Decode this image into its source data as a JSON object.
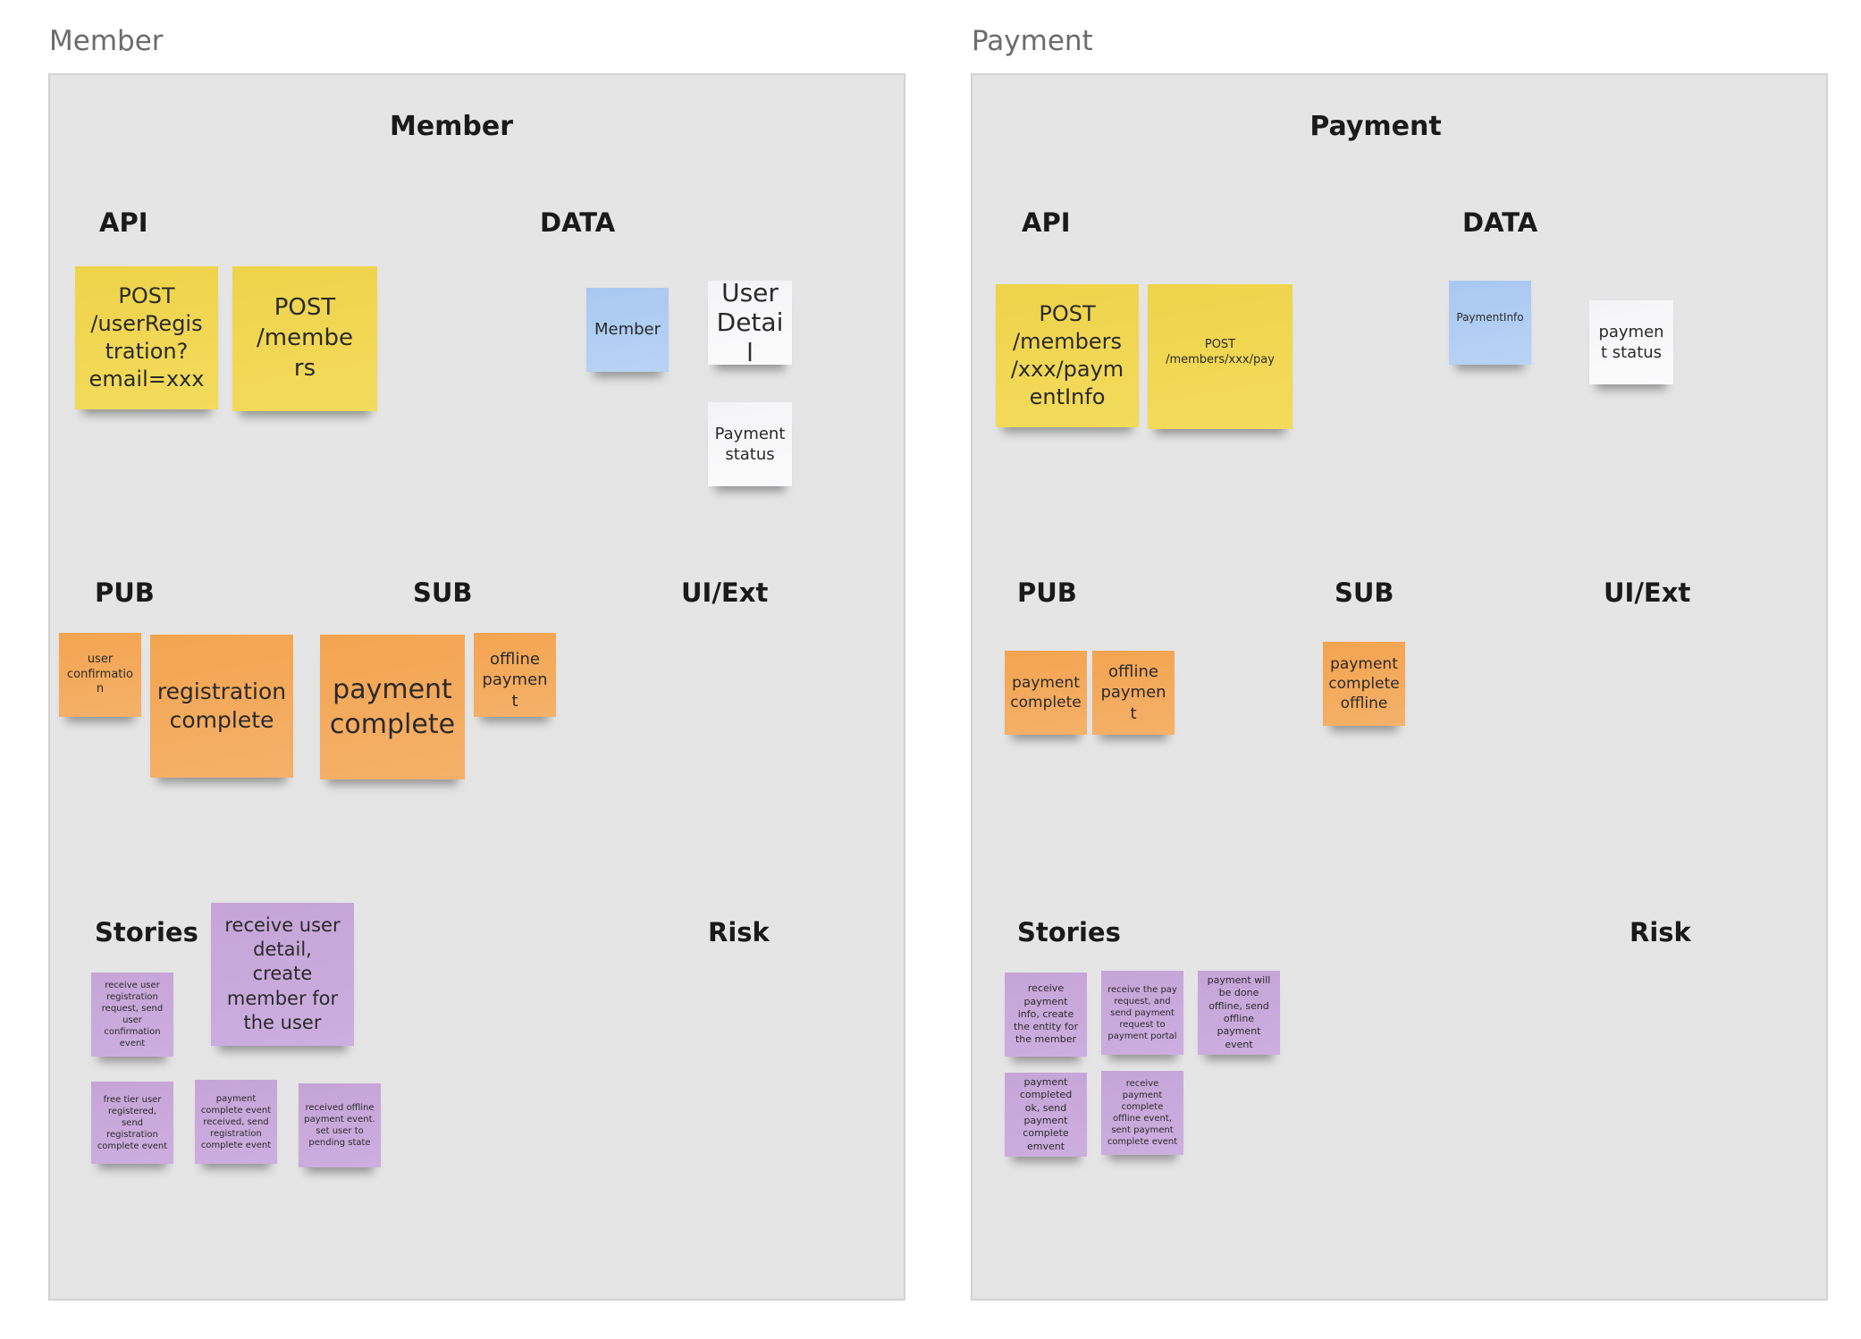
{
  "frames": {
    "member": {
      "label": "Member",
      "title": "Member",
      "headings": {
        "api": "API",
        "data": "DATA",
        "pub": "PUB",
        "sub": "SUB",
        "ui": "UI/Ext",
        "stories": "Stories",
        "risk": "Risk"
      },
      "api": [
        {
          "text": "POST /userRegistration?email=xxx",
          "color": "yellow"
        },
        {
          "text": "POST /members",
          "color": "yellow"
        }
      ],
      "data": [
        {
          "text": "Member",
          "color": "blue"
        },
        {
          "text": "User Detail",
          "color": "white"
        },
        {
          "text": "Payment status",
          "color": "white"
        }
      ],
      "pub": [
        {
          "text": "user confirmation",
          "color": "orange"
        },
        {
          "text": "registration complete",
          "color": "orange"
        }
      ],
      "sub": [
        {
          "text": "payment complete",
          "color": "orange"
        },
        {
          "text": "offline payment",
          "color": "orange"
        }
      ],
      "stories": [
        {
          "text": "receive user detail, create member for the user",
          "color": "purple"
        },
        {
          "text": "receive user registration request, send user confirmation event",
          "color": "purple"
        },
        {
          "text": "free tier user registered, send registration complete event",
          "color": "purple"
        },
        {
          "text": "payment complete event received, send registration complete event",
          "color": "purple"
        },
        {
          "text": "received offline payment event. set user to pending state",
          "color": "purple"
        }
      ]
    },
    "payment": {
      "label": "Payment",
      "title": "Payment",
      "headings": {
        "api": "API",
        "data": "DATA",
        "pub": "PUB",
        "sub": "SUB",
        "ui": "UI/Ext",
        "stories": "Stories",
        "risk": "Risk"
      },
      "api": [
        {
          "text": "POST /members/xxx/paymentInfo",
          "color": "yellow"
        },
        {
          "text": "POST /members/xxx/pay",
          "color": "yellow"
        }
      ],
      "data": [
        {
          "text": "PaymentInfo",
          "color": "blue"
        },
        {
          "text": "payment status",
          "color": "white"
        }
      ],
      "pub": [
        {
          "text": "payment complete",
          "color": "orange"
        },
        {
          "text": "offline payment",
          "color": "orange"
        }
      ],
      "sub": [
        {
          "text": "payment complete offline",
          "color": "orange"
        }
      ],
      "stories": [
        {
          "text": "receive payment info, create the entity for the member",
          "color": "purple"
        },
        {
          "text": "receive the pay request, and send payment request to payment portal",
          "color": "purple"
        },
        {
          "text": "payment will be done offline, send offline payment event",
          "color": "purple"
        },
        {
          "text": "payment completed ok, send payment complete emvent",
          "color": "purple"
        },
        {
          "text": "receive payment complete offline event, sent payment complete event",
          "color": "purple"
        }
      ]
    }
  },
  "colors": {
    "yellow": "#f1d54f",
    "orange": "#f4a858",
    "blue": "#afcdf4",
    "white": "#f7f7f8",
    "purple": "#c9a8dc",
    "frame_bg": "#e5e5e5"
  }
}
